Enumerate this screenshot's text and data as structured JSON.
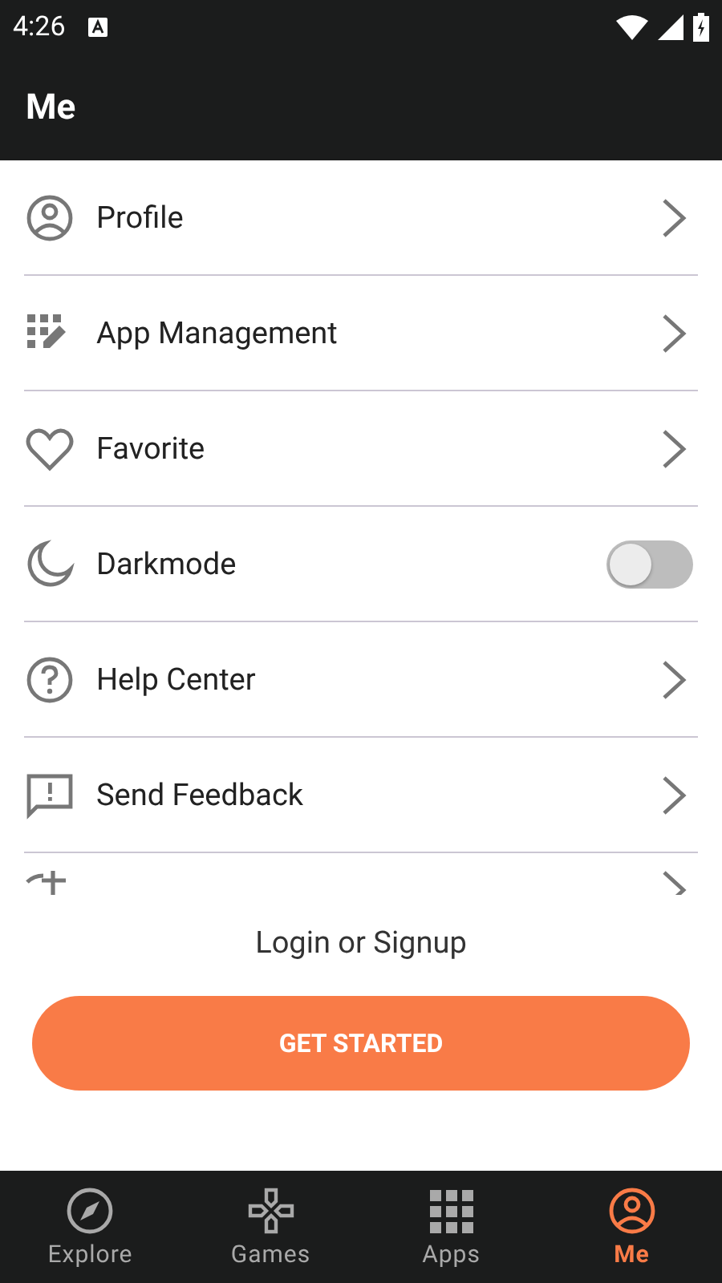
{
  "status_bar": {
    "time": "4:26"
  },
  "header": {
    "title": "Me"
  },
  "items": [
    {
      "kind": "link",
      "label": "Profile"
    },
    {
      "kind": "link",
      "label": "App Management"
    },
    {
      "kind": "link",
      "label": "Favorite"
    },
    {
      "kind": "toggle",
      "label": "Darkmode",
      "on": false
    },
    {
      "kind": "link",
      "label": "Help Center"
    },
    {
      "kind": "link",
      "label": "Send Feedback"
    },
    {
      "kind": "link"
    }
  ],
  "login": {
    "text": "Login or Signup",
    "button": "GET STARTED"
  },
  "nav": [
    {
      "label": "Explore",
      "selected": false
    },
    {
      "label": "Games",
      "selected": false
    },
    {
      "label": "Apps",
      "selected": false
    },
    {
      "label": "Me",
      "selected": true
    }
  ]
}
